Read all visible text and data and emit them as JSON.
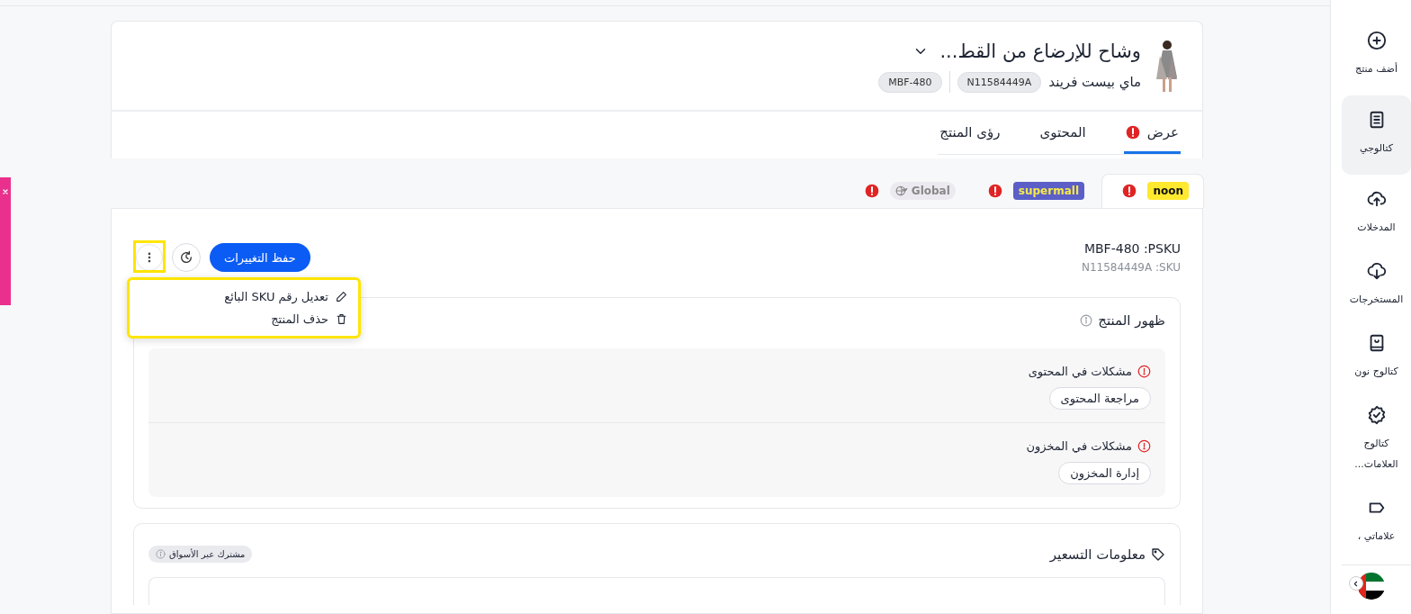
{
  "sidebar": {
    "items": [
      {
        "label": "أضف منتج",
        "selected": false
      },
      {
        "label": "كتالوجي",
        "selected": true
      },
      {
        "label": "المدخلات",
        "selected": false
      },
      {
        "label": "المستخرجات",
        "selected": false
      },
      {
        "label": "كتالوج نون",
        "selected": false
      },
      {
        "label": "كتالوج العلامات...",
        "selected": false
      },
      {
        "label": "علاماتي ،",
        "selected": false
      }
    ]
  },
  "product": {
    "title": "وشاح للإرضاع من القط...",
    "brand": "ماي بيست فريند",
    "badges": [
      "N11584449A",
      "MBF-480"
    ]
  },
  "tabs": [
    {
      "label": "عرض",
      "warning": true,
      "selected": true
    },
    {
      "label": "المحتوى",
      "warning": false,
      "selected": false
    },
    {
      "label": "رؤى المنتج",
      "warning": false,
      "selected": false
    }
  ],
  "marketplaces": [
    {
      "label": "noon",
      "warning": true,
      "selected": true
    },
    {
      "label": "supermall",
      "warning": true,
      "selected": false
    },
    {
      "label": "Global",
      "warning": true,
      "selected": false
    }
  ],
  "sku": {
    "psku": "MBF-480 :PSKU",
    "sku": "N11584449A :SKU"
  },
  "actions": {
    "save": "حفظ التغييرات",
    "more_highlighted": true,
    "menu_open": true,
    "menu_highlighted": true,
    "menu": [
      {
        "label": "تعديل رقم SKU البائع"
      },
      {
        "label": "حذف المنتج"
      }
    ]
  },
  "visibility": {
    "title": "ظهور المنتج",
    "issues": [
      {
        "title": "مشكلات في المحتوى",
        "action": "مراجعة المحتوى"
      },
      {
        "title": "مشكلات في المخزون",
        "action": "إدارة المخزون"
      }
    ]
  },
  "pricing": {
    "title": "معلومات التسعير",
    "shared_badge": "مشترك عبر الأسواق"
  }
}
